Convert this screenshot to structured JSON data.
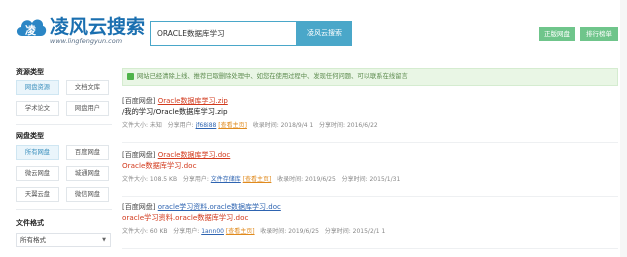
{
  "header": {
    "logo_name": "凌风云搜索",
    "logo_url": "www.lingfengyun.com",
    "search_value": "ORACLE数据库学习",
    "search_button": "凌风云搜索",
    "btn_jp": "正版网盘",
    "btn_ph": "排行榜单"
  },
  "sidebar": {
    "resource_title": "资源类型",
    "resource_items": [
      "网盘资源",
      "文档文库",
      "学术论文",
      "网盘用户"
    ],
    "disk_title": "网盘类型",
    "disk_items": [
      "所有网盘",
      "百度网盘",
      "微云网盘",
      "城通网盘",
      "天翼云盘",
      "微信网盘"
    ],
    "format_title": "文件格式",
    "format_selected": "所有格式"
  },
  "notice": "网站已经清除上线、推荐已取删除处理中、如您在使用过程中、发现任何问题、可以联系在线留言",
  "results": [
    {
      "line1_prefix": "[百度网盘]",
      "line1_link": "Oracle数据库学习.zip",
      "line2": "/我的学习/Oracle数据库学习.zip",
      "meta_size": "文件大小: 未知",
      "meta_share": "分享用户:",
      "meta_user": "jf68i88",
      "meta_tag": "[查看主页]",
      "meta_collect": "收录时间: 2018/9/4 1",
      "meta_time": "分享时间: 2016/6/22"
    },
    {
      "line1_prefix": "[百度网盘]",
      "line1_link": "Oracle数据库学习.doc",
      "line2": "Oracle数据库学习.doc",
      "meta_size": "文件大小: 108.5 KB",
      "meta_share": "分享用户:",
      "meta_user": "文件存储库",
      "meta_tag": "[查看主页]",
      "meta_collect": "收录时间: 2019/6/25",
      "meta_time": "分享时间: 2015/1/31"
    },
    {
      "line1_prefix": "[百度网盘]",
      "line1_link": "oracle学习资料.oracle数据库学习.doc",
      "line2": "oracle学习资料.oracle数据库学习.doc",
      "meta_size": "文件大小: 60 KB",
      "meta_share": "分享用户:",
      "meta_user": "1ann00",
      "meta_tag": "[查看主页]",
      "meta_collect": "收录时间: 2019/6/25",
      "meta_time": "分享时间: 2015/2/1 1"
    }
  ],
  "colors": {
    "brand": "#1a6fb0",
    "accent": "#4aa7c9",
    "green": "#6fc58b",
    "link_red": "#d2391c"
  }
}
